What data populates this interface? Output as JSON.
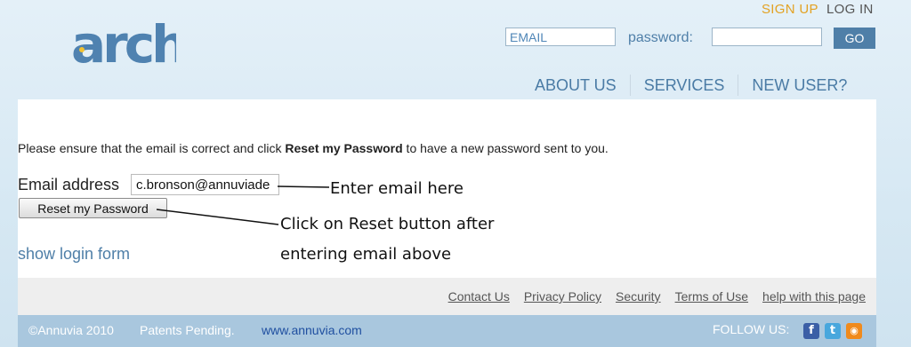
{
  "header": {
    "logo_text": "arch",
    "signup_label": "SIGN UP",
    "login_label": "LOG IN",
    "email_placeholder": "EMAIL",
    "password_label": "password:",
    "go_label": "GO"
  },
  "nav": {
    "items": [
      {
        "label": "ABOUT US"
      },
      {
        "label": "SERVICES"
      },
      {
        "label": "NEW USER?"
      }
    ]
  },
  "reset": {
    "instructions_prefix": "Please ensure that the email is correct and click ",
    "instructions_bold": "Reset my Password",
    "instructions_suffix": " to have a new password sent to you.",
    "email_label": "Email address",
    "email_value": "c.bronson@annuviade",
    "button_label": "Reset my Password",
    "show_login_label": "show login form"
  },
  "annotations": {
    "email_note": "Enter email here",
    "button_note_line1": "Click on Reset button after",
    "button_note_line2": "entering email above"
  },
  "footer": {
    "links": [
      {
        "label": "Contact Us"
      },
      {
        "label": "Privacy Policy"
      },
      {
        "label": "Security"
      },
      {
        "label": "Terms of Use"
      },
      {
        "label": "help with this page"
      }
    ],
    "copyright": "©Annuvia 2010",
    "patents": "Patents Pending.",
    "site": "www.annuvia.com",
    "follow_label": "FOLLOW US:",
    "social_icons": [
      "facebook-icon",
      "twitter-icon",
      "rss-icon"
    ]
  },
  "colors": {
    "accent": "#4f7fa8",
    "signup": "#e3a223",
    "footer_bar": "#a9c7de"
  }
}
